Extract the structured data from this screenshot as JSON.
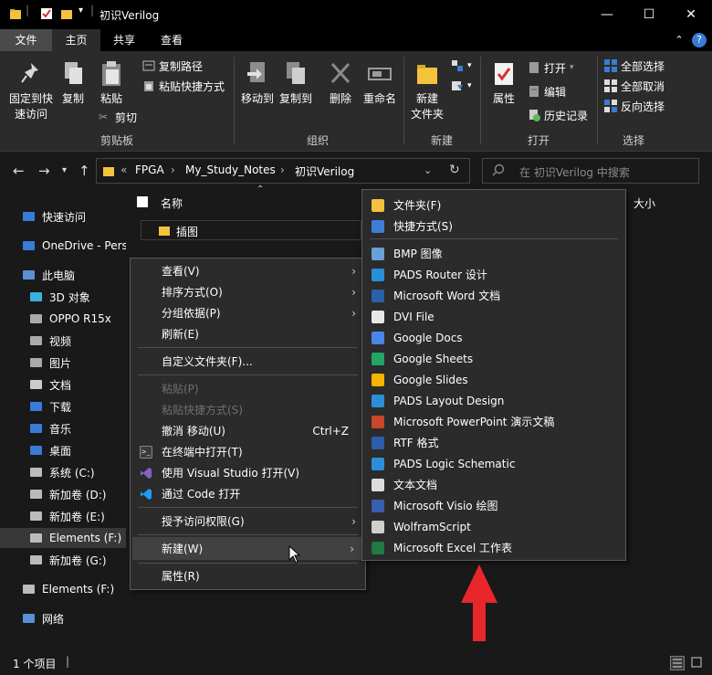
{
  "window": {
    "title": "初识Verilog",
    "minimize": "—",
    "maximize": "☐",
    "close": "✕"
  },
  "tabs": [
    "文件",
    "主页",
    "共享",
    "查看"
  ],
  "ribbon": {
    "clipboard": {
      "pin": "固定到快速访问",
      "copy": "复制",
      "paste": "粘贴",
      "copy_path": "复制路径",
      "paste_shortcut": "粘贴快捷方式",
      "cut": "剪切",
      "label": "剪贴板"
    },
    "organize": {
      "move_to": "移动到",
      "copy_to": "复制到",
      "delete": "删除",
      "rename": "重命名",
      "label": "组织"
    },
    "new": {
      "new_folder": "新建\n文件夹",
      "label": "新建"
    },
    "open": {
      "properties": "属性",
      "open": "打开",
      "edit": "编辑",
      "history": "历史记录",
      "label": "打开"
    },
    "select": {
      "select_all": "全部选择",
      "select_none": "全部取消",
      "invert": "反向选择",
      "label": "选择"
    }
  },
  "address": {
    "prefix": "«",
    "crumbs": [
      "FPGA",
      "My_Study_Notes",
      "初识Verilog"
    ],
    "search_placeholder": "在 初识Verilog 中搜索"
  },
  "columns": {
    "name": "名称",
    "size": "大小"
  },
  "files": [
    {
      "name": "插图"
    }
  ],
  "nav": [
    {
      "label": "快速访问",
      "icon": "star-icon"
    },
    {
      "label": "OneDrive - Pers",
      "icon": "cloud-icon"
    },
    {
      "label": "此电脑",
      "icon": "computer-icon"
    },
    {
      "label": "3D 对象",
      "icon": "cube-icon"
    },
    {
      "label": "OPPO R15x",
      "icon": "phone-icon"
    },
    {
      "label": "视频",
      "icon": "video-icon"
    },
    {
      "label": "图片",
      "icon": "picture-icon"
    },
    {
      "label": "文档",
      "icon": "document-icon"
    },
    {
      "label": "下载",
      "icon": "download-icon"
    },
    {
      "label": "音乐",
      "icon": "music-icon"
    },
    {
      "label": "桌面",
      "icon": "desktop-icon"
    },
    {
      "label": "系统 (C:)",
      "icon": "drive-icon"
    },
    {
      "label": "新加卷 (D:)",
      "icon": "drive-icon"
    },
    {
      "label": "新加卷 (E:)",
      "icon": "drive-icon"
    },
    {
      "label": "Elements (F:)",
      "icon": "drive-icon"
    },
    {
      "label": "新加卷 (G:)",
      "icon": "drive-icon"
    },
    {
      "label": "Elements (F:)",
      "icon": "drive-icon"
    },
    {
      "label": "网络",
      "icon": "network-icon"
    }
  ],
  "context_menu": {
    "view": "查看(V)",
    "sort": "排序方式(O)",
    "group": "分组依据(P)",
    "refresh": "刷新(E)",
    "customize": "自定义文件夹(F)...",
    "paste": "粘贴(P)",
    "paste_shortcut": "粘贴快捷方式(S)",
    "undo": "撤消 移动(U)",
    "undo_shortcut": "Ctrl+Z",
    "terminal": "在终端中打开(T)",
    "vs": "使用 Visual Studio 打开(V)",
    "code": "通过 Code 打开",
    "access": "授予访问权限(G)",
    "new": "新建(W)",
    "properties": "属性(R)"
  },
  "new_submenu": [
    {
      "label": "文件夹(F)",
      "icon": "folder-icon",
      "color": "#f5c33b"
    },
    {
      "label": "快捷方式(S)",
      "icon": "shortcut-icon",
      "color": "#3d7fd6"
    },
    {
      "label": "BMP 图像",
      "icon": "bmp-icon",
      "color": "#6aa0d8"
    },
    {
      "label": "PADS Router 设计",
      "icon": "pads-router-icon",
      "color": "#2a8fd6"
    },
    {
      "label": "Microsoft Word 文档",
      "icon": "word-icon",
      "color": "#2b5faa"
    },
    {
      "label": "DVI File",
      "icon": "dvi-icon",
      "color": "#e8e8e8"
    },
    {
      "label": "Google Docs",
      "icon": "google-docs-icon",
      "color": "#4a86e8"
    },
    {
      "label": "Google Sheets",
      "icon": "google-sheets-icon",
      "color": "#23a566"
    },
    {
      "label": "Google Slides",
      "icon": "google-slides-icon",
      "color": "#f6b400"
    },
    {
      "label": "PADS Layout Design",
      "icon": "pads-layout-icon",
      "color": "#2a8fd6"
    },
    {
      "label": "Microsoft PowerPoint 演示文稿",
      "icon": "powerpoint-icon",
      "color": "#c9472b"
    },
    {
      "label": "RTF 格式",
      "icon": "rtf-icon",
      "color": "#2b5faa"
    },
    {
      "label": "PADS Logic Schematic",
      "icon": "pads-logic-icon",
      "color": "#2a8fd6"
    },
    {
      "label": "文本文档",
      "icon": "text-doc-icon",
      "color": "#dddddd"
    },
    {
      "label": "Microsoft Visio 绘图",
      "icon": "visio-icon",
      "color": "#3a5fb0"
    },
    {
      "label": "WolframScript",
      "icon": "wolfram-icon",
      "color": "#cfcfcf"
    },
    {
      "label": "Microsoft Excel 工作表",
      "icon": "excel-icon",
      "color": "#1f7a45"
    }
  ],
  "status": {
    "count": "1 个项目",
    "cursor": "|"
  },
  "colors": {
    "accent": "#3a7bd5",
    "annotation_arrow": "#e8262b",
    "folder": "#f5c33b"
  }
}
